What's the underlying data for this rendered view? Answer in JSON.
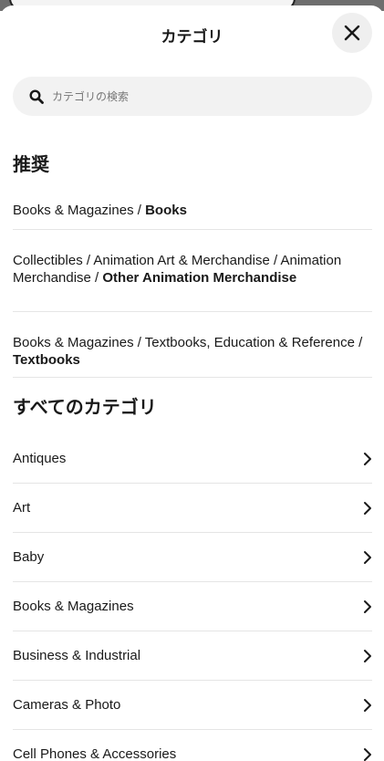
{
  "header": {
    "title": "カテゴリ",
    "close_icon": "close-icon"
  },
  "search": {
    "placeholder": "カテゴリの検索",
    "icon": "search-icon"
  },
  "recommended": {
    "title": "推奨",
    "items": [
      {
        "path": "Books & Magazines / ",
        "leaf": "Books"
      },
      {
        "path": "Collectibles / Animation Art & Merchandise / Animation Merchandise / ",
        "leaf": "Other Animation Merchandise"
      },
      {
        "path": "Books & Magazines / Textbooks, Education & Reference / ",
        "leaf": "Textbooks"
      }
    ]
  },
  "all_categories": {
    "title": "すべてのカテゴリ",
    "items": [
      {
        "label": "Antiques"
      },
      {
        "label": "Art"
      },
      {
        "label": "Baby"
      },
      {
        "label": "Books & Magazines"
      },
      {
        "label": "Business & Industrial"
      },
      {
        "label": "Cameras & Photo"
      },
      {
        "label": "Cell Phones & Accessories"
      }
    ]
  }
}
